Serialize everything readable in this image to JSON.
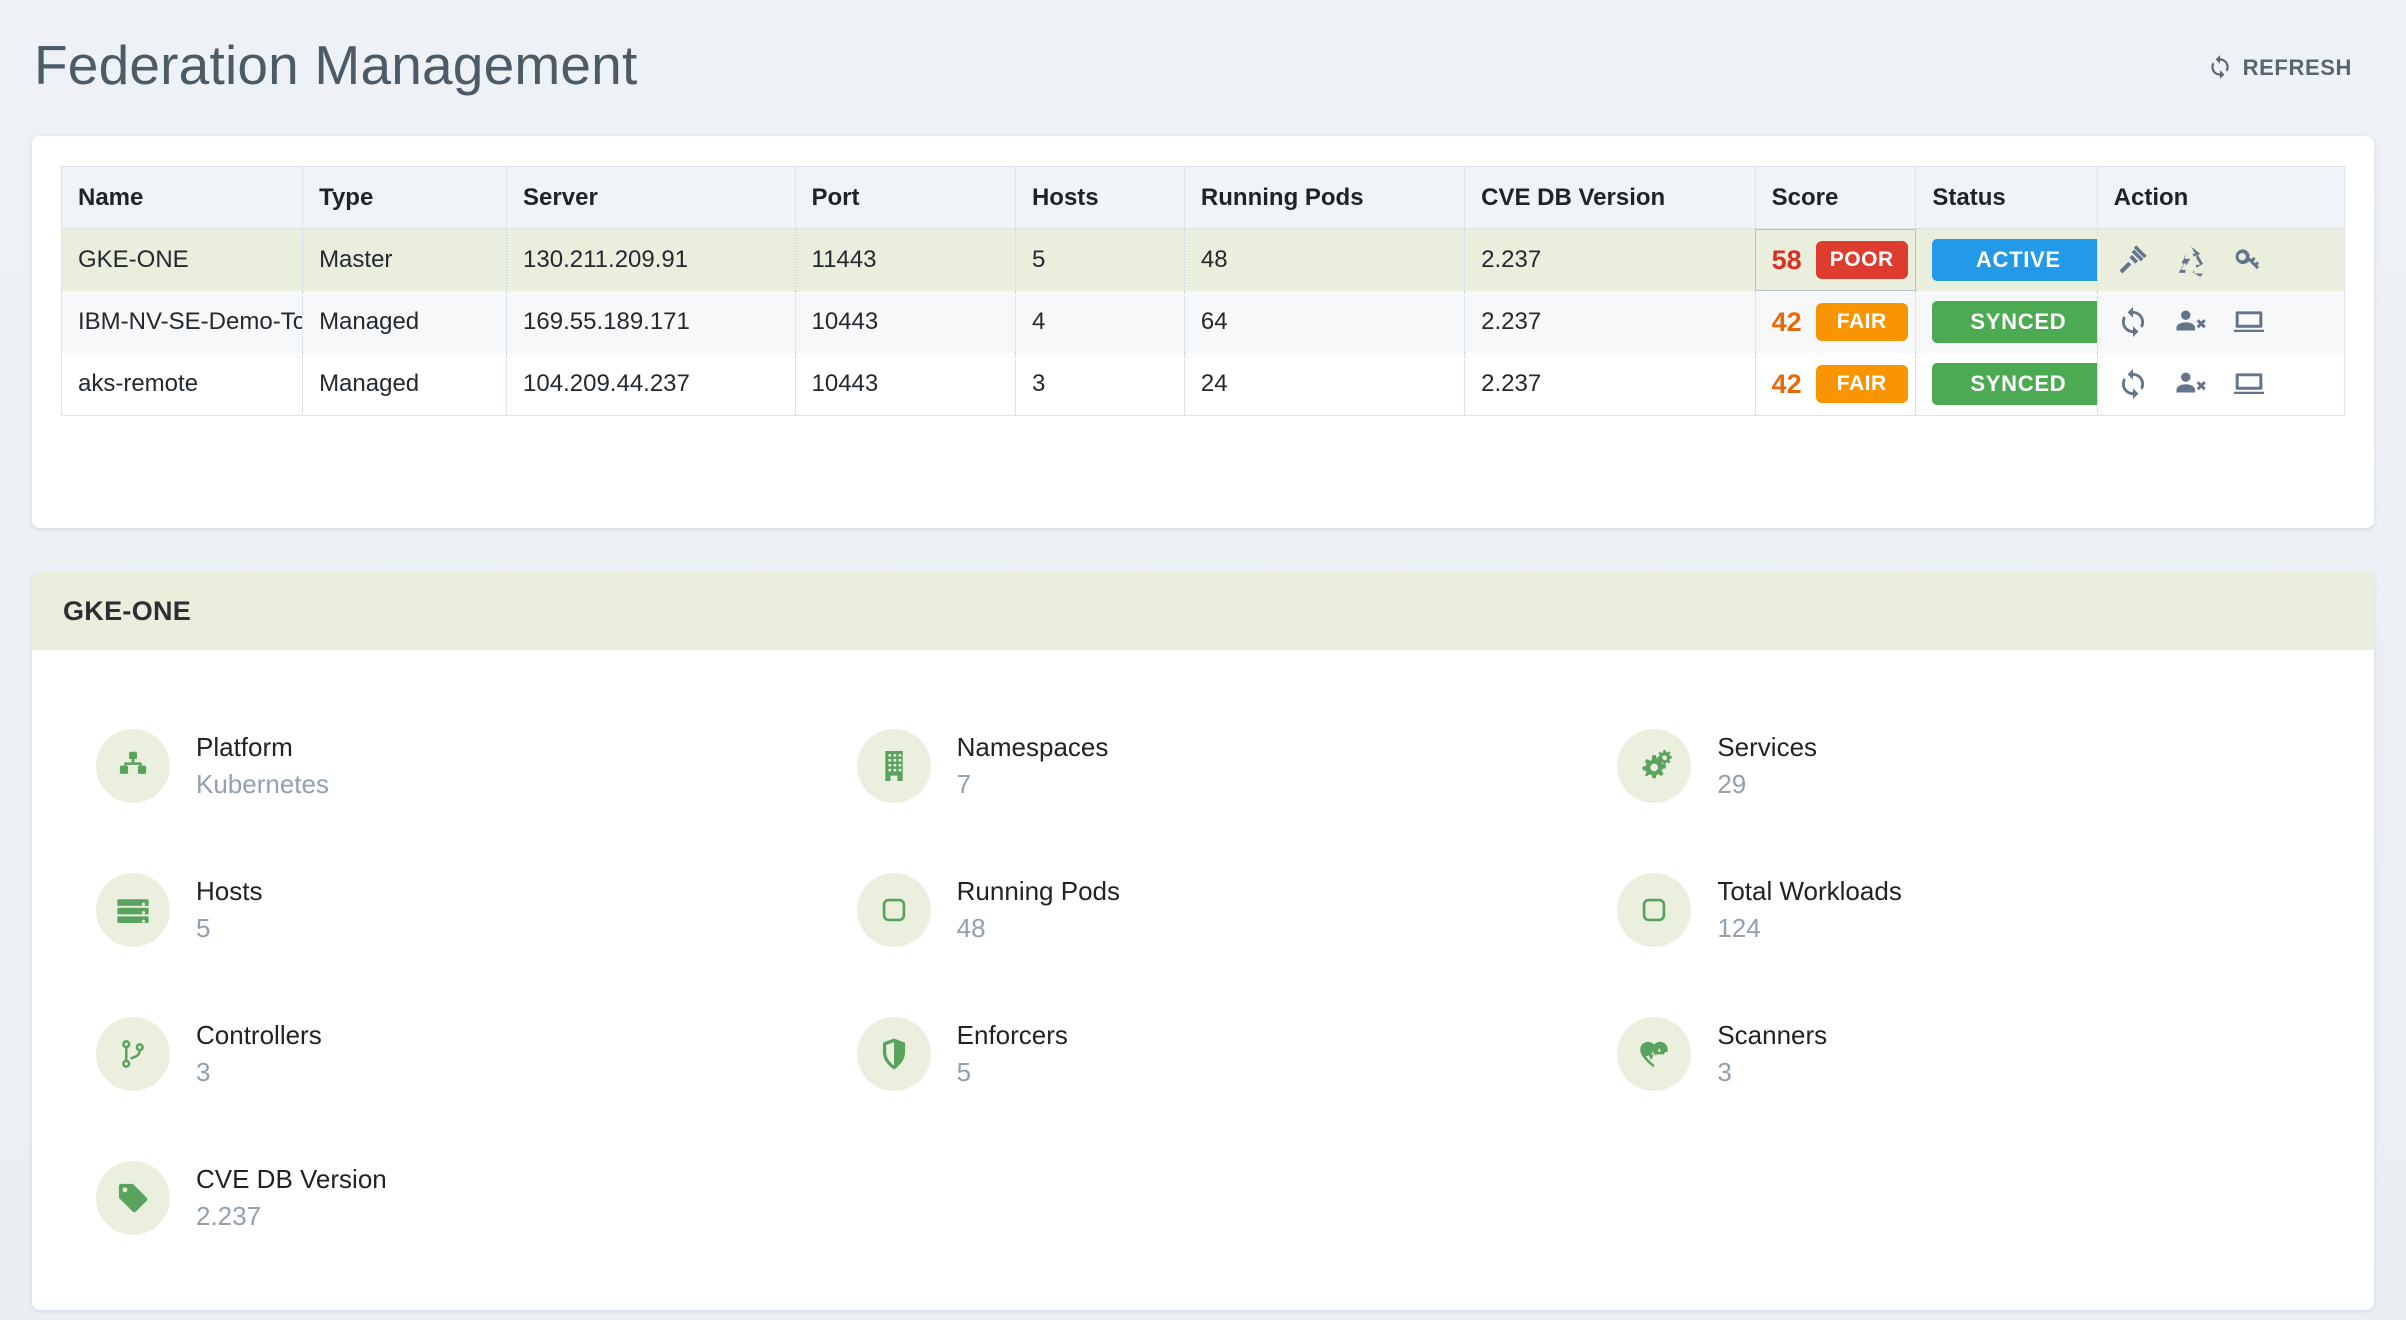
{
  "header": {
    "title": "Federation Management",
    "refresh_label": "REFRESH",
    "refresh_icon": "refresh-icon"
  },
  "table": {
    "columns": [
      "Name",
      "Type",
      "Server",
      "Port",
      "Hosts",
      "Running Pods",
      "CVE DB Version",
      "Score",
      "Status",
      "Action"
    ],
    "rows": [
      {
        "name": "GKE-ONE",
        "type": "Master",
        "server": "130.211.209.91",
        "port": "11443",
        "hosts": "5",
        "running_pods": "48",
        "cve_db_version": "2.237",
        "score": "58",
        "score_label": "POOR",
        "score_level": "poor",
        "status": "ACTIVE",
        "status_level": "active",
        "actions": [
          "gavel-icon",
          "recycle-icon",
          "key-icon"
        ],
        "selected": true
      },
      {
        "name": "IBM-NV-SE-Demo-Toror",
        "type": "Managed",
        "server": "169.55.189.171",
        "port": "10443",
        "hosts": "4",
        "running_pods": "64",
        "cve_db_version": "2.237",
        "score": "42",
        "score_label": "FAIR",
        "score_level": "fair",
        "status": "SYNCED",
        "status_level": "synced",
        "actions": [
          "sync-icon",
          "user-remove-icon",
          "monitor-icon"
        ],
        "selected": false
      },
      {
        "name": "aks-remote",
        "type": "Managed",
        "server": "104.209.44.237",
        "port": "10443",
        "hosts": "3",
        "running_pods": "24",
        "cve_db_version": "2.237",
        "score": "42",
        "score_label": "FAIR",
        "score_level": "fair",
        "status": "SYNCED",
        "status_level": "synced",
        "actions": [
          "sync-icon",
          "user-remove-icon",
          "monitor-icon"
        ],
        "selected": false
      }
    ]
  },
  "detail": {
    "title": "GKE-ONE",
    "items": [
      {
        "label": "Platform",
        "value": "Kubernetes",
        "icon": "sitemap-icon"
      },
      {
        "label": "Namespaces",
        "value": "7",
        "icon": "building-icon"
      },
      {
        "label": "Services",
        "value": "29",
        "icon": "gears-icon"
      },
      {
        "label": "Hosts",
        "value": "5",
        "icon": "server-icon"
      },
      {
        "label": "Running Pods",
        "value": "48",
        "icon": "pod-icon"
      },
      {
        "label": "Total Workloads",
        "value": "124",
        "icon": "pod-icon"
      },
      {
        "label": "Controllers",
        "value": "3",
        "icon": "code-branch-icon"
      },
      {
        "label": "Enforcers",
        "value": "5",
        "icon": "shield-icon"
      },
      {
        "label": "Scanners",
        "value": "3",
        "icon": "heartbeat-icon"
      },
      {
        "label": "CVE DB Version",
        "value": "2.237",
        "icon": "tag-icon"
      }
    ]
  },
  "colors": {
    "accent_green": "#5aa35f",
    "poor_red": "#dd3c2e",
    "fair_orange": "#f99500",
    "active_blue": "#239ae8",
    "synced_green": "#4cab52",
    "selected_row": "#eaeedd",
    "page_bg": "#eef2f6"
  }
}
